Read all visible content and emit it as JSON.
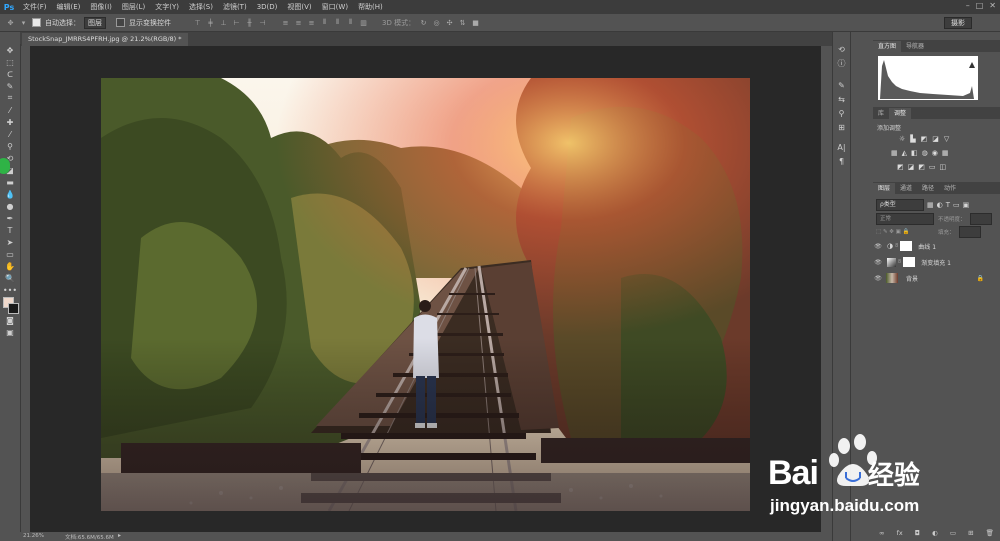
{
  "app": {
    "logo": "Ps"
  },
  "menu": {
    "items": [
      "文件(F)",
      "编辑(E)",
      "图像(I)",
      "图层(L)",
      "文字(Y)",
      "选择(S)",
      "滤镜(T)",
      "3D(D)",
      "视图(V)",
      "窗口(W)",
      "帮助(H)"
    ]
  },
  "options": {
    "auto_select_label": "自动选择：",
    "auto_select_value": "图层",
    "show_transform_label": "显示变换控件",
    "mode_3d_label": "3D 模式：",
    "workspace": "摄影"
  },
  "document": {
    "tab_title": "StockSnap_JMRRS4PFRH.jpg @ 21.2%(RGB/8) *"
  },
  "status": {
    "zoom": "21.26%",
    "doc_size": "文档:65.6M/65.6M"
  },
  "histogram_panel": {
    "tabs": [
      "直方图",
      "导航器"
    ]
  },
  "adjust_panel": {
    "tabs": [
      "库",
      "调整"
    ],
    "title": "添加调整"
  },
  "layers_panel": {
    "tabs": [
      "图层",
      "通道",
      "路径",
      "动作"
    ],
    "filter_label": "ρ类型",
    "blend_mode": "正常",
    "opacity_label": "不透明度：",
    "fill_label": "填充：",
    "layers": [
      {
        "name": "曲线 1"
      },
      {
        "name": "渐变填充 1"
      },
      {
        "name": "背景"
      }
    ]
  },
  "watermark": {
    "brand": "Bai",
    "brand2": "经验",
    "url": "jingyan.baidu.com"
  },
  "colors": {
    "accent": "#31a8ff",
    "panel": "#535353",
    "canvas_bg": "#282828"
  }
}
